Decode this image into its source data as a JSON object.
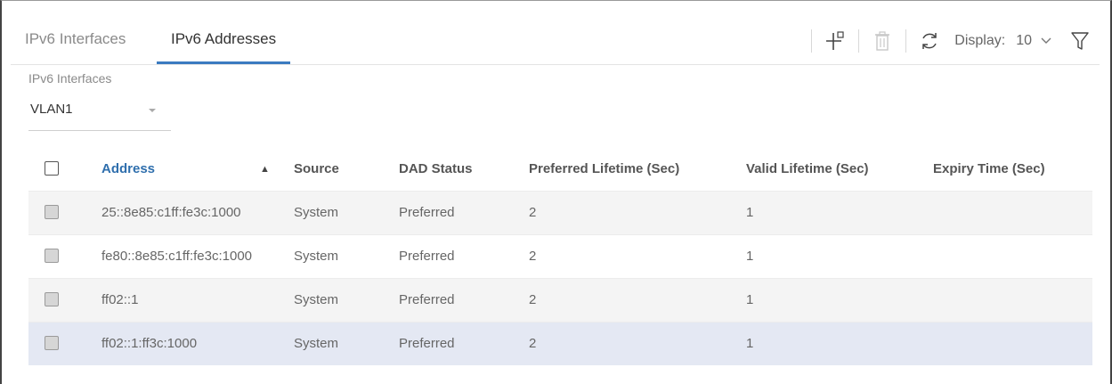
{
  "tabs": [
    {
      "label": "IPv6 Interfaces",
      "active": false
    },
    {
      "label": "IPv6 Addresses",
      "active": true
    }
  ],
  "toolbar": {
    "add_icon": "add-icon",
    "delete_icon": "trash-icon",
    "refresh_icon": "refresh-icon",
    "display_label": "Display:",
    "display_value": "10",
    "filter_icon": "filter-icon"
  },
  "interfaces": {
    "label": "IPv6 Interfaces",
    "value": "VLAN1"
  },
  "table": {
    "headers": {
      "address": "Address",
      "source": "Source",
      "dad_status": "DAD Status",
      "preferred_lifetime": "Preferred Lifetime (Sec)",
      "valid_lifetime": "Valid Lifetime (Sec)",
      "expiry_time": "Expiry Time (Sec)"
    },
    "sort_indicator": "▲",
    "rows": [
      {
        "address": "25::8e85:c1ff:fe3c:1000",
        "source": "System",
        "dad_status": "Preferred",
        "preferred_lifetime": "2",
        "valid_lifetime": "1",
        "expiry_time": ""
      },
      {
        "address": "fe80::8e85:c1ff:fe3c:1000",
        "source": "System",
        "dad_status": "Preferred",
        "preferred_lifetime": "2",
        "valid_lifetime": "1",
        "expiry_time": ""
      },
      {
        "address": "ff02::1",
        "source": "System",
        "dad_status": "Preferred",
        "preferred_lifetime": "2",
        "valid_lifetime": "1",
        "expiry_time": ""
      },
      {
        "address": "ff02::1:ff3c:1000",
        "source": "System",
        "dad_status": "Preferred",
        "preferred_lifetime": "2",
        "valid_lifetime": "1",
        "expiry_time": ""
      }
    ]
  },
  "colors": {
    "accent": "#3b7bc0",
    "link": "#2f6fad",
    "row_alt": "#f4f4f4",
    "row_selected": "#e4e8f3"
  }
}
